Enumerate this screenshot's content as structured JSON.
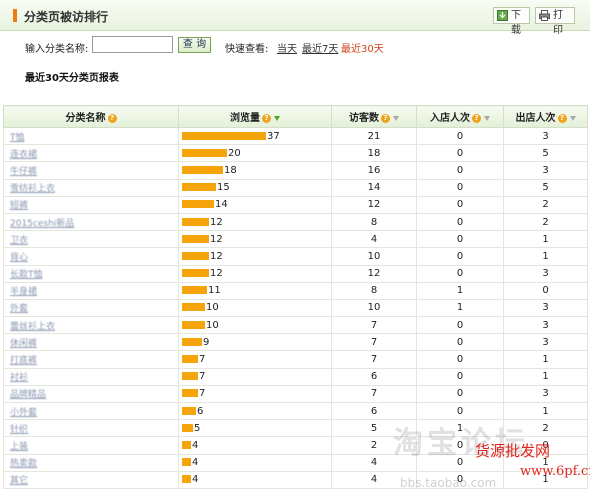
{
  "header": {
    "title": "分类页被访排行",
    "download_label": "下载",
    "print_label": "打印"
  },
  "filters": {
    "category_label": "输入分类名称:",
    "category_value": "",
    "query_label": "查 询",
    "quick_label": "快速查看:",
    "today": "当天",
    "last7": "最近7天",
    "last30": "最近30天"
  },
  "report_title": "最近30天分类页报表",
  "table": {
    "columns": [
      "分类名称",
      "浏览量",
      "访客数",
      "入店人次",
      "出店人次"
    ],
    "rows": [
      {
        "name": "T恤",
        "pv": 37,
        "uv": 21,
        "in": 0,
        "out": 3
      },
      {
        "name": "连衣裙",
        "pv": 20,
        "uv": 18,
        "in": 0,
        "out": 5
      },
      {
        "name": "牛仔裤",
        "pv": 18,
        "uv": 16,
        "in": 0,
        "out": 3
      },
      {
        "name": "雪纺衫上衣",
        "pv": 15,
        "uv": 14,
        "in": 0,
        "out": 5
      },
      {
        "name": "短裤",
        "pv": 14,
        "uv": 12,
        "in": 0,
        "out": 2
      },
      {
        "name": "2015ceshi新品",
        "pv": 12,
        "uv": 8,
        "in": 0,
        "out": 2
      },
      {
        "name": "卫衣",
        "pv": 12,
        "uv": 4,
        "in": 0,
        "out": 1
      },
      {
        "name": "背心",
        "pv": 12,
        "uv": 10,
        "in": 0,
        "out": 1
      },
      {
        "name": "长款T恤",
        "pv": 12,
        "uv": 12,
        "in": 0,
        "out": 3
      },
      {
        "name": "半身裙",
        "pv": 11,
        "uv": 8,
        "in": 1,
        "out": 0
      },
      {
        "name": "外套",
        "pv": 10,
        "uv": 10,
        "in": 1,
        "out": 3
      },
      {
        "name": "蕾丝衫上衣",
        "pv": 10,
        "uv": 7,
        "in": 0,
        "out": 3
      },
      {
        "name": "休闲裤",
        "pv": 9,
        "uv": 7,
        "in": 0,
        "out": 3
      },
      {
        "name": "打底裤",
        "pv": 7,
        "uv": 7,
        "in": 0,
        "out": 1
      },
      {
        "name": "衬衫",
        "pv": 7,
        "uv": 6,
        "in": 0,
        "out": 1
      },
      {
        "name": "品牌精品",
        "pv": 7,
        "uv": 7,
        "in": 0,
        "out": 3
      },
      {
        "name": "小外套",
        "pv": 6,
        "uv": 6,
        "in": 0,
        "out": 1
      },
      {
        "name": "针织",
        "pv": 5,
        "uv": 5,
        "in": 1,
        "out": 2
      },
      {
        "name": "上装",
        "pv": 4,
        "uv": 2,
        "in": 0,
        "out": 0
      },
      {
        "name": "热卖款",
        "pv": 4,
        "uv": 4,
        "in": 0,
        "out": 1
      },
      {
        "name": "其它",
        "pv": 4,
        "uv": 4,
        "in": 0,
        "out": 1
      }
    ]
  },
  "watermark": {
    "text": "淘宝论坛",
    "url": "bbs.taobao.com",
    "brand": "货源批发网",
    "brand_url": "www.6pf.cn"
  },
  "colors": {
    "bar": "#f5a40b",
    "accent": "#f07b12",
    "active_link": "#d0431a"
  }
}
